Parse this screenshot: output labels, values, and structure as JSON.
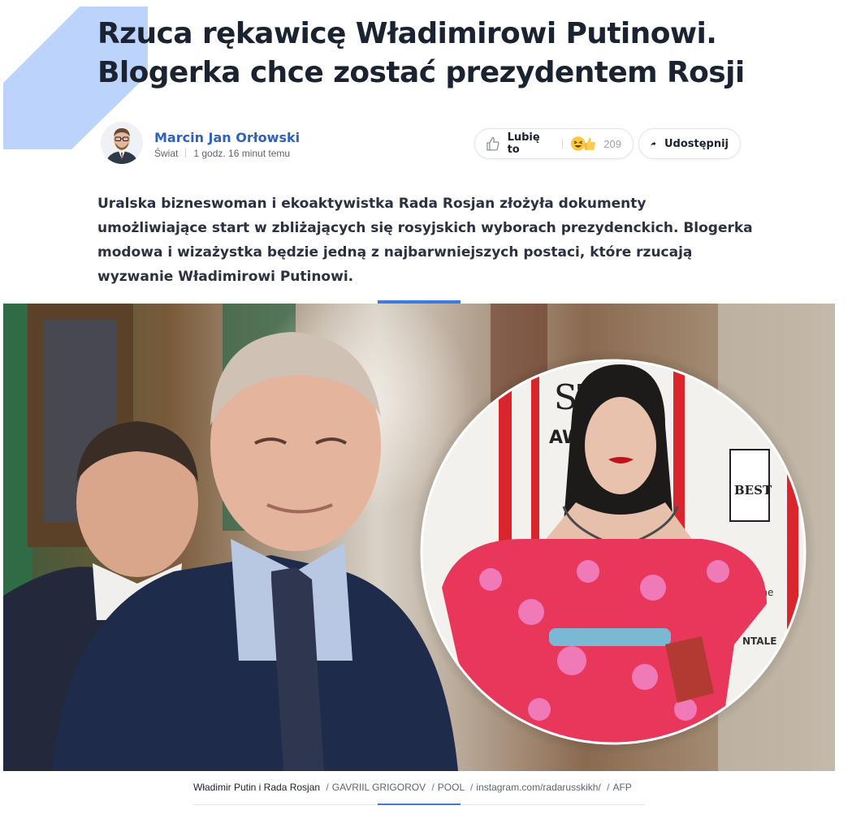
{
  "article": {
    "title": "Rzuca rękawicę Władimirowi Putinowi. Blogerka chce zostać prezydentem Rosji",
    "author": "Marcin Jan Orłowski",
    "section": "Świat",
    "time": "1 godz. 16 minut temu",
    "lead": "Uralska bizneswoman i ekoaktywistka Rada Rosjan złożyła dokumenty umożliwiające start w zbliżających się rosyjskich wyborach prezydenckich. Blogerka modowa i wizażystka będzie jedną z najbarwniejszych postaci, które rzucają wyzwanie Władimirowi Putinowi."
  },
  "reactions": {
    "like_label": "Lubię to",
    "like_icon": "thumbs-up-outline-icon",
    "emoji_icons": [
      "laughing-face-icon",
      "thumbs-up-emoji-icon"
    ],
    "count": "209",
    "share_label": "Udostępnij",
    "share_icon": "share-arrow-icon"
  },
  "photo": {
    "caption": "Władimir Putin i Rada Rosjan",
    "credits": [
      "GAVRIIL GRIGOROV",
      "POOL",
      "instagram.com/radarusskikh/",
      "AFP"
    ],
    "inset_text": [
      "ST",
      "AW",
      "BEST",
      "taine",
      "NTALE"
    ]
  },
  "colors": {
    "accent": "#3d7be0",
    "author_link": "#2f5fbf",
    "title": "#1b2331",
    "deco": "#bcd3fb"
  }
}
